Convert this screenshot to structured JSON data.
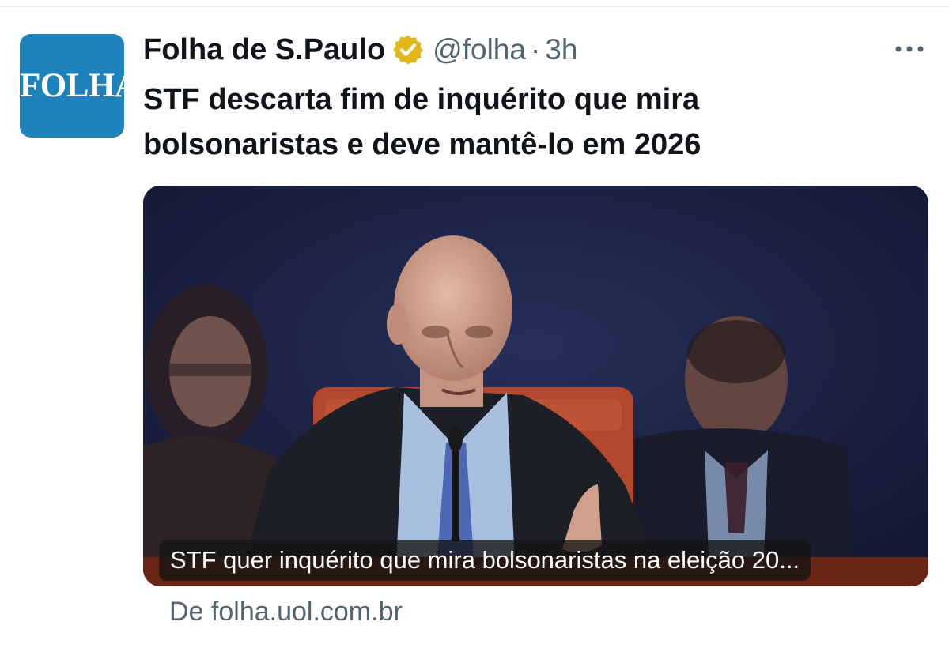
{
  "tweet": {
    "avatar_text": "FOLHA",
    "display_name": "Folha de S.Paulo",
    "verified_icon": "verified-badge-gold",
    "handle": "@folha",
    "separator": "·",
    "time": "3h",
    "headline": "STF descarta fim de inquérito que mira bolsonaristas e deve mantê-lo em 2026",
    "card": {
      "caption": "STF quer inquérito que mira bolsonaristas na eleição 20...",
      "source": "De folha.uol.com.br"
    }
  },
  "colors": {
    "avatar_bg": "#1e83bd",
    "verified_gold": "#e2b719",
    "secondary_text": "#536471",
    "primary_text": "#0f1419"
  }
}
